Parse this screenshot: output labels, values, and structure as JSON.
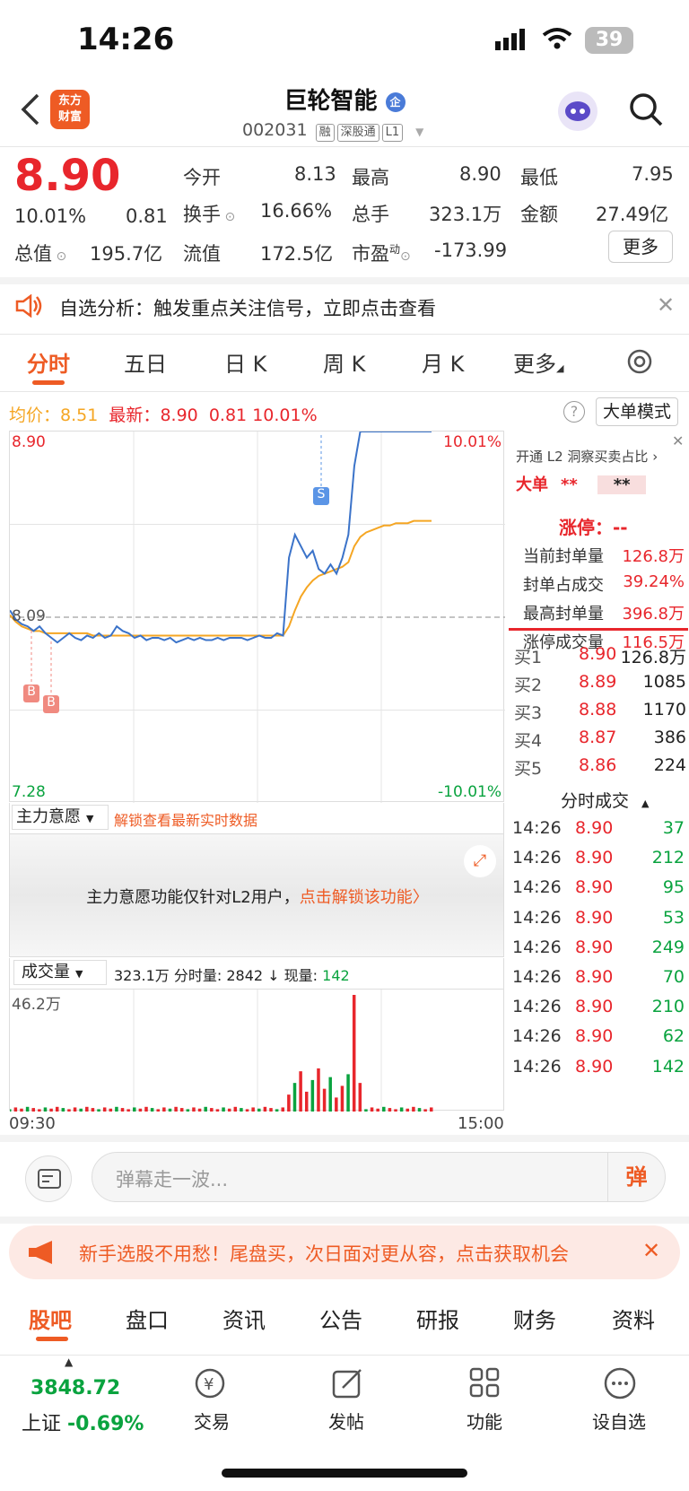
{
  "status": {
    "time": "14:26",
    "battery": "39"
  },
  "header": {
    "logo_line1": "东方",
    "logo_line2": "财富",
    "title": "巨轮智能",
    "badge": "企",
    "code": "002031",
    "tags": [
      "融",
      "深股通",
      "L1"
    ]
  },
  "quote": {
    "price": "8.90",
    "pct": "10.01%",
    "change": "0.81",
    "jinkai_l": "今开",
    "jinkai": "8.13",
    "zuigao_l": "最高",
    "zuigao": "8.90",
    "zuidi_l": "最低",
    "zuidi": "7.95",
    "huanshou_l": "换手",
    "huanshou": "16.66%",
    "zongshou_l": "总手",
    "zongshou": "323.1万",
    "jine_l": "金额",
    "jine": "27.49亿",
    "zongzhi_l": "总值",
    "zongzhi": "195.7亿",
    "liuzhi_l": "流值",
    "liuzhi": "172.5亿",
    "shiying_l": "市盈",
    "shiying_sup": "动",
    "shiying": "-173.99",
    "more": "更多"
  },
  "notice": {
    "text": "自选分析：触发重点关注信号，立即点击查看"
  },
  "tabs": [
    "分时",
    "五日",
    "日 K",
    "周 K",
    "月 K",
    "更多"
  ],
  "info": {
    "avg_label": "均价：",
    "avg": "8.51",
    "latest_label": "最新：",
    "latest": "8.90",
    "chg": "0.81",
    "pct": "10.01%",
    "big_mode": "大单模式"
  },
  "chart_data": {
    "type": "line",
    "ylim": [
      7.28,
      8.9
    ],
    "y_labels": {
      "top": "8.90",
      "mid": "8.09",
      "bottom": "7.28",
      "top_pct": "10.01%",
      "bottom_pct": "-10.01%"
    },
    "x_labels": [
      "09:30",
      "15:00"
    ],
    "price": [
      8.12,
      8.08,
      8.06,
      8.05,
      8.03,
      8.05,
      8.02,
      8.0,
      7.98,
      8.0,
      8.02,
      8.0,
      7.99,
      8.01,
      8.0,
      8.02,
      8.0,
      8.01,
      8.05,
      8.03,
      8.02,
      8.0,
      8.01,
      7.99,
      8.0,
      8.0,
      7.99,
      8.0,
      7.98,
      7.99,
      8.0,
      7.99,
      8.0,
      7.99,
      7.99,
      8.0,
      7.99,
      8.0,
      8.0,
      8.0,
      7.99,
      8.0,
      8.01,
      8.0,
      8.0,
      8.02,
      8.01,
      8.35,
      8.45,
      8.4,
      8.35,
      8.38,
      8.3,
      8.28,
      8.32,
      8.28,
      8.35,
      8.45,
      8.75,
      8.9,
      8.9,
      8.9,
      8.9,
      8.9,
      8.9,
      8.9,
      8.9,
      8.9,
      8.9,
      8.9,
      8.9,
      8.9
    ],
    "avg": [
      8.1,
      8.07,
      8.05,
      8.04,
      8.03,
      8.03,
      8.02,
      8.02,
      8.02,
      8.02,
      8.02,
      8.02,
      8.02,
      8.02,
      8.01,
      8.01,
      8.01,
      8.01,
      8.01,
      8.01,
      8.01,
      8.01,
      8.01,
      8.01,
      8.01,
      8.01,
      8.01,
      8.01,
      8.01,
      8.01,
      8.01,
      8.01,
      8.01,
      8.01,
      8.01,
      8.01,
      8.01,
      8.01,
      8.01,
      8.01,
      8.01,
      8.01,
      8.01,
      8.01,
      8.01,
      8.01,
      8.01,
      8.05,
      8.12,
      8.18,
      8.22,
      8.25,
      8.27,
      8.28,
      8.29,
      8.3,
      8.31,
      8.33,
      8.4,
      8.44,
      8.46,
      8.47,
      8.48,
      8.49,
      8.49,
      8.5,
      8.5,
      8.5,
      8.51,
      8.51,
      8.51,
      8.51
    ],
    "volume_label": "46.2万"
  },
  "markers": {
    "buy": "B",
    "sell": "S"
  },
  "zhuli": {
    "label": "主力意愿",
    "unlock": "解锁查看最新实时数据",
    "msg": "主力意愿功能仅针对L2用户，",
    "msg_link": "点击解锁该功能〉"
  },
  "volbar": {
    "label": "成交量",
    "text": "323.1万 分时量: 2842 ↓ 现量:",
    "now": "142"
  },
  "right": {
    "l2_title": "开通 L2 洞察买卖占比",
    "big_label": "大单",
    "big_val": "**",
    "big_val2": "**",
    "zt_label": "涨停：",
    "zt_val": "--",
    "rows": [
      {
        "k": "当前封单量",
        "v": "126.8万"
      },
      {
        "k": "封单占成交",
        "v": "39.24%"
      },
      {
        "k": "最高封单量",
        "v": "396.8万"
      },
      {
        "k": "涨停成交量",
        "v": "116.5万"
      }
    ],
    "bids": [
      {
        "k": "买1",
        "p": "8.90",
        "v": "126.8万"
      },
      {
        "k": "买2",
        "p": "8.89",
        "v": "1085"
      },
      {
        "k": "买3",
        "p": "8.88",
        "v": "1170"
      },
      {
        "k": "买4",
        "p": "8.87",
        "v": "386"
      },
      {
        "k": "买5",
        "p": "8.86",
        "v": "224"
      }
    ],
    "ticks_title": "分时成交",
    "ticks": [
      {
        "t": "14:26",
        "p": "8.90",
        "v": "37"
      },
      {
        "t": "14:26",
        "p": "8.90",
        "v": "212"
      },
      {
        "t": "14:26",
        "p": "8.90",
        "v": "95"
      },
      {
        "t": "14:26",
        "p": "8.90",
        "v": "53"
      },
      {
        "t": "14:26",
        "p": "8.90",
        "v": "249"
      },
      {
        "t": "14:26",
        "p": "8.90",
        "v": "70"
      },
      {
        "t": "14:26",
        "p": "8.90",
        "v": "210"
      },
      {
        "t": "14:26",
        "p": "8.90",
        "v": "62"
      },
      {
        "t": "14:26",
        "p": "8.90",
        "v": "142"
      }
    ]
  },
  "comment": {
    "placeholder": "弹幕走一波...",
    "btn": "弹"
  },
  "promo": {
    "text": "新手选股不用愁！尾盘买，次日面对更从容，点击获取机会"
  },
  "btabs": [
    "股吧",
    "盘口",
    "资讯",
    "公告",
    "研报",
    "财务",
    "资料"
  ],
  "bottom": {
    "index": "3848.72",
    "index_name": "上证",
    "index_pct": "-0.69%",
    "items": [
      "交易",
      "发帖",
      "功能",
      "设自选"
    ]
  }
}
